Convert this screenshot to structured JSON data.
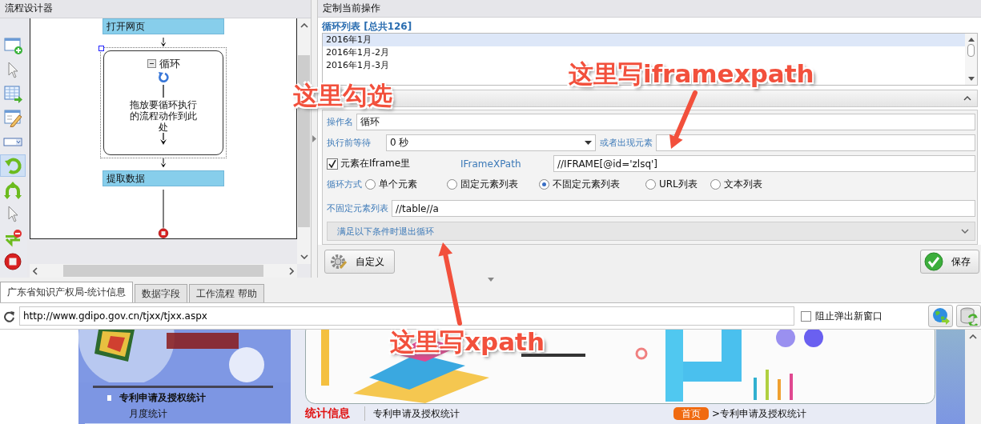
{
  "flow_designer": {
    "title": "流程设计器",
    "tools": [
      {
        "kind": "page-add",
        "selected": false
      },
      {
        "kind": "pointer",
        "selected": false
      },
      {
        "kind": "table-export",
        "selected": false
      },
      {
        "kind": "form-edit",
        "selected": false
      },
      {
        "kind": "dropdown",
        "selected": false
      },
      {
        "kind": "loop",
        "selected": true
      },
      {
        "kind": "branch",
        "selected": false
      },
      {
        "kind": "pointer",
        "selected": false
      },
      {
        "kind": "loop-exit",
        "selected": false
      },
      {
        "kind": "stop",
        "selected": false
      }
    ],
    "diagram": {
      "nodes": [
        {
          "kind": "action",
          "label": "打开网页"
        },
        {
          "kind": "loop",
          "label": "循环",
          "hint": "拖放要循环执行的流程动作到此处",
          "expanded": true,
          "selected": true
        },
        {
          "kind": "action",
          "label": "提取数据"
        },
        {
          "kind": "end"
        }
      ]
    }
  },
  "operation_panel": {
    "title": "定制当前操作",
    "loop_list": {
      "label": "循环列表 [总共126]",
      "items": [
        {
          "text": "2016年1月",
          "selected": true
        },
        {
          "text": "2016年1月-2月",
          "selected": false
        },
        {
          "text": "2016年1月-3月",
          "selected": false
        }
      ]
    },
    "section": {
      "expanded": true
    },
    "form": {
      "name": {
        "label": "操作名",
        "value": "循环"
      },
      "wait": {
        "label": "执行前等待",
        "value": "0 秒"
      },
      "appear": {
        "label": "或者出现元素"
      },
      "in_iframe": {
        "label": "元素在Iframe里",
        "checked": true
      },
      "iframe_xpath": {
        "label": "IFrameXPath",
        "value": "//IFRAME[@id='zlsq']"
      },
      "loop_mode": {
        "label": "循环方式",
        "options": [
          {
            "label": "单个元素",
            "selected": false
          },
          {
            "label": "固定元素列表",
            "selected": false
          },
          {
            "label": "不固定元素列表",
            "selected": true
          },
          {
            "label": "URL列表",
            "selected": false
          },
          {
            "label": "文本列表",
            "selected": false
          }
        ]
      },
      "element_list": {
        "label": "不固定元素列表",
        "value": "//table//a"
      },
      "exit_condition": {
        "label": "满足以下条件时退出循环",
        "expanded": false
      }
    },
    "buttons": [
      {
        "kind": "custom",
        "label": "自定义"
      },
      {
        "kind": "save",
        "label": "保存"
      }
    ]
  },
  "browser": {
    "tabs": [
      {
        "label": "广东省知识产权局-统计信息",
        "selected": true
      },
      {
        "label": "数据字段",
        "selected": false
      },
      {
        "label": "工作流程 帮助",
        "selected": false
      }
    ],
    "url": "http://www.gdipo.gov.cn/tjxx/tjxx.aspx",
    "block_popups": {
      "label": "阻止弹出新窗口",
      "checked": false
    },
    "page": {
      "menu": [
        {
          "kind": "heading",
          "text": "专利申请及授权统计"
        },
        {
          "kind": "item",
          "text": "月度统计"
        }
      ],
      "section_title": "统计信息",
      "section_link": "专利申请及授权统计",
      "breadcrumb": {
        "home": "首页",
        "path": ">专利申请及授权统计"
      }
    }
  },
  "annotations": [
    {
      "text": "这里勾选"
    },
    {
      "text": "这里写iframexpath"
    },
    {
      "text": "这里写xpath"
    }
  ]
}
